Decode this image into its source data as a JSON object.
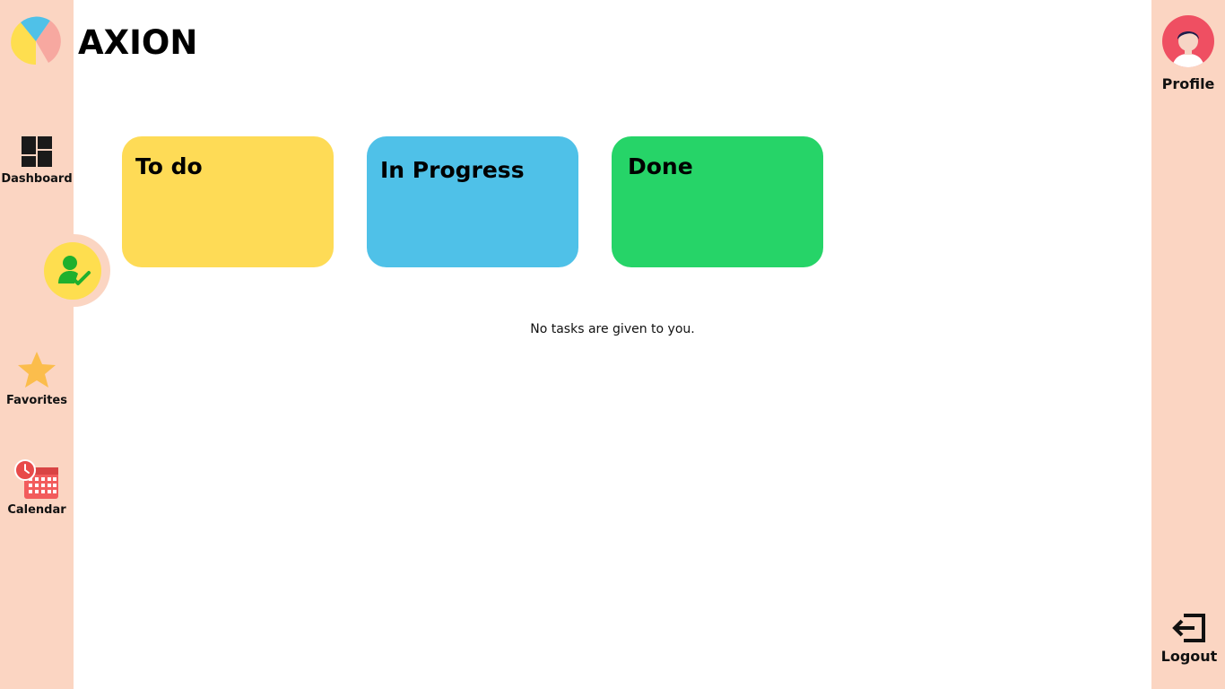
{
  "app": {
    "title": "AXION",
    "logo_icon": "pie-logo-icon"
  },
  "sidebar": {
    "items": [
      {
        "label": "Dashboard",
        "icon": "dashboard-grid-icon"
      },
      {
        "label": "",
        "icon": "user-check-icon",
        "active": true
      },
      {
        "label": "Favorites",
        "icon": "star-icon"
      },
      {
        "label": "Calendar",
        "icon": "calendar-clock-icon"
      }
    ]
  },
  "profile": {
    "label": "Profile",
    "icon": "avatar-icon"
  },
  "logout": {
    "label": "Logout",
    "icon": "logout-arrow-icon"
  },
  "columns": [
    {
      "title": "To do",
      "color": "#fedb56"
    },
    {
      "title": "In Progress",
      "color": "#4fc1e8"
    },
    {
      "title": "Done",
      "color": "#26d468"
    }
  ],
  "empty_message": "No tasks are given to you.",
  "colors": {
    "sidebar_bg": "#fbd5c2",
    "active_bubble": "#fede4f",
    "accent_green": "#1fb02d"
  }
}
